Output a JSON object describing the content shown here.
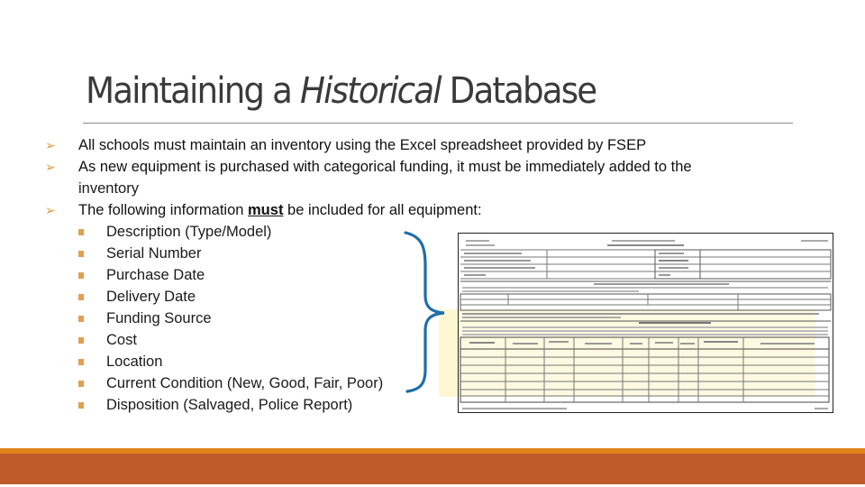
{
  "slide": {
    "title": {
      "part1": "Maintaining a ",
      "italic": "Historical",
      "part2": " Database"
    },
    "bullets": [
      {
        "text": "All schools must maintain an inventory using the Excel spreadsheet provided by FSEP"
      },
      {
        "text": "As new equipment is purchased with categorical funding, it must be immediately added to the",
        "continuation": "inventory"
      },
      {
        "before": "The following information ",
        "emphasis": "must",
        "after": " be included for all equipment:"
      }
    ],
    "required_fields": [
      "Description (Type/Model)",
      "Serial Number",
      "Purchase Date",
      "Delivery Date",
      "Funding Source",
      "Cost",
      "Location",
      "Current Condition (New, Good, Fair, Poor)",
      "Disposition (Salvaged, Police Report)"
    ],
    "icons": {
      "level1_bullet": "arrow-bullet-icon",
      "level2_bullet": "square-bullet-icon",
      "brace": "right-curly-brace-icon"
    },
    "colors": {
      "title": "#3a3a3a",
      "rule": "#8a8a8a",
      "arrow_bullet": "#d99a3f",
      "square_bullet": "#e0a050",
      "brace": "#1f6fa8",
      "highlight": "#fdf8d2",
      "footer_strip": "#e0821a",
      "footer_bar": "#be5a2c"
    },
    "form_image": {
      "description": "Scanned equipment inventory form (illegible at this resolution)"
    }
  }
}
